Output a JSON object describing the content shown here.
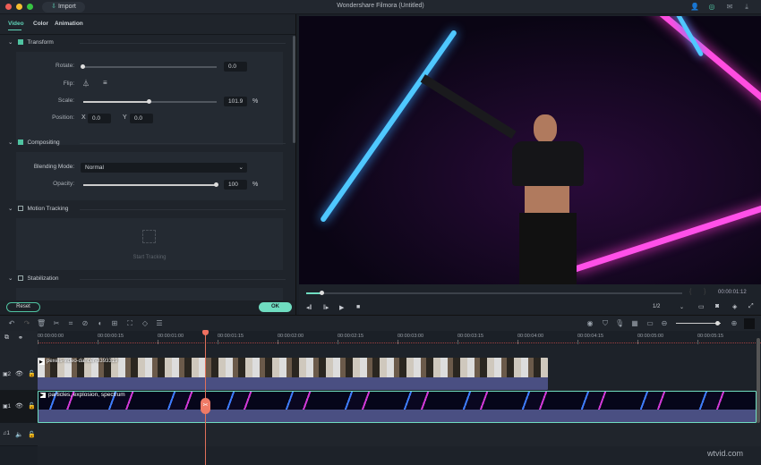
{
  "window": {
    "title": "Wondershare Filmora (Untitled)",
    "import_label": "Import",
    "header_icons": [
      "account-icon",
      "support-icon",
      "mail-icon",
      "download-icon"
    ]
  },
  "tabs": [
    "Video",
    "Color",
    "Animation"
  ],
  "transform": {
    "title": "Transform",
    "checked": true,
    "rotate_label": "Rotate:",
    "rotate_value": "0.0",
    "flip_label": "Flip:",
    "scale_label": "Scale:",
    "scale_value": "101.9",
    "scale_unit": "%",
    "position_label": "Position:",
    "x_label": "X",
    "x_value": "0.0",
    "y_label": "Y",
    "y_value": "0.0"
  },
  "compositing": {
    "title": "Compositing",
    "checked": true,
    "blend_label": "Blending Mode:",
    "blend_value": "Normal",
    "opacity_label": "Opacity:",
    "opacity_value": "100",
    "opacity_unit": "%"
  },
  "motion_tracking": {
    "title": "Motion Tracking",
    "checked": false,
    "start_label": "Start Tracking"
  },
  "stabilization": {
    "title": "Stabilization",
    "checked": false
  },
  "buttons": {
    "reset": "Reset",
    "ok": "OK"
  },
  "player": {
    "timecode": "00:00:01:12",
    "quality": "1/2",
    "progress": 0.04
  },
  "timeline": {
    "ruler": [
      "00:00:00:00",
      "00:00:00:15",
      "00:00:01:00",
      "00:00:01:15",
      "00:00:02:00",
      "00:00:02:15",
      "00:00:03:00",
      "00:00:03:15",
      "00:00:04:00",
      "00:00:04:15",
      "00:00:05:00",
      "00:00:05:15"
    ],
    "tracks": [
      {
        "label": "2",
        "clip": "pexels-video-dancer-3393319"
      },
      {
        "label": "1",
        "clip": "particles, explosion, spectrum"
      },
      {
        "label": "1"
      }
    ]
  },
  "watermark": "wtvid.com"
}
